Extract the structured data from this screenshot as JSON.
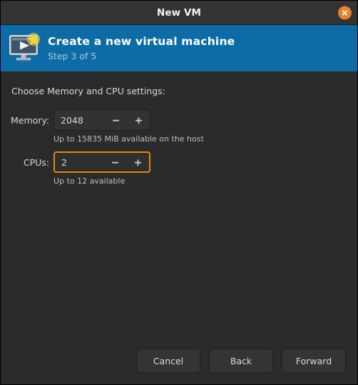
{
  "window": {
    "title": "New VM",
    "close_icon": "close-icon"
  },
  "banner": {
    "icon": "new-virtual-machine-icon",
    "title": "Create a new virtual machine",
    "step": "Step 3 of 5",
    "background_color": "#0d6ca5"
  },
  "content": {
    "intro": "Choose Memory and CPU settings:",
    "fields": [
      {
        "label": "Memory:",
        "value": "2048",
        "decrement_icon": "minus-icon",
        "increment_icon": "plus-icon",
        "hint": "Up to 15835 MiB available on the host",
        "focused": false
      },
      {
        "label": "CPUs:",
        "value": "2",
        "decrement_icon": "minus-icon",
        "increment_icon": "plus-icon",
        "hint": "Up to 12 available",
        "focused": true
      }
    ]
  },
  "footer": {
    "cancel_label": "Cancel",
    "back_label": "Back",
    "forward_label": "Forward"
  },
  "colors": {
    "accent_orange": "#e8860d",
    "banner_blue": "#0d6ca5",
    "window_background": "#2b2b2b",
    "titlebar_background": "#333333"
  }
}
